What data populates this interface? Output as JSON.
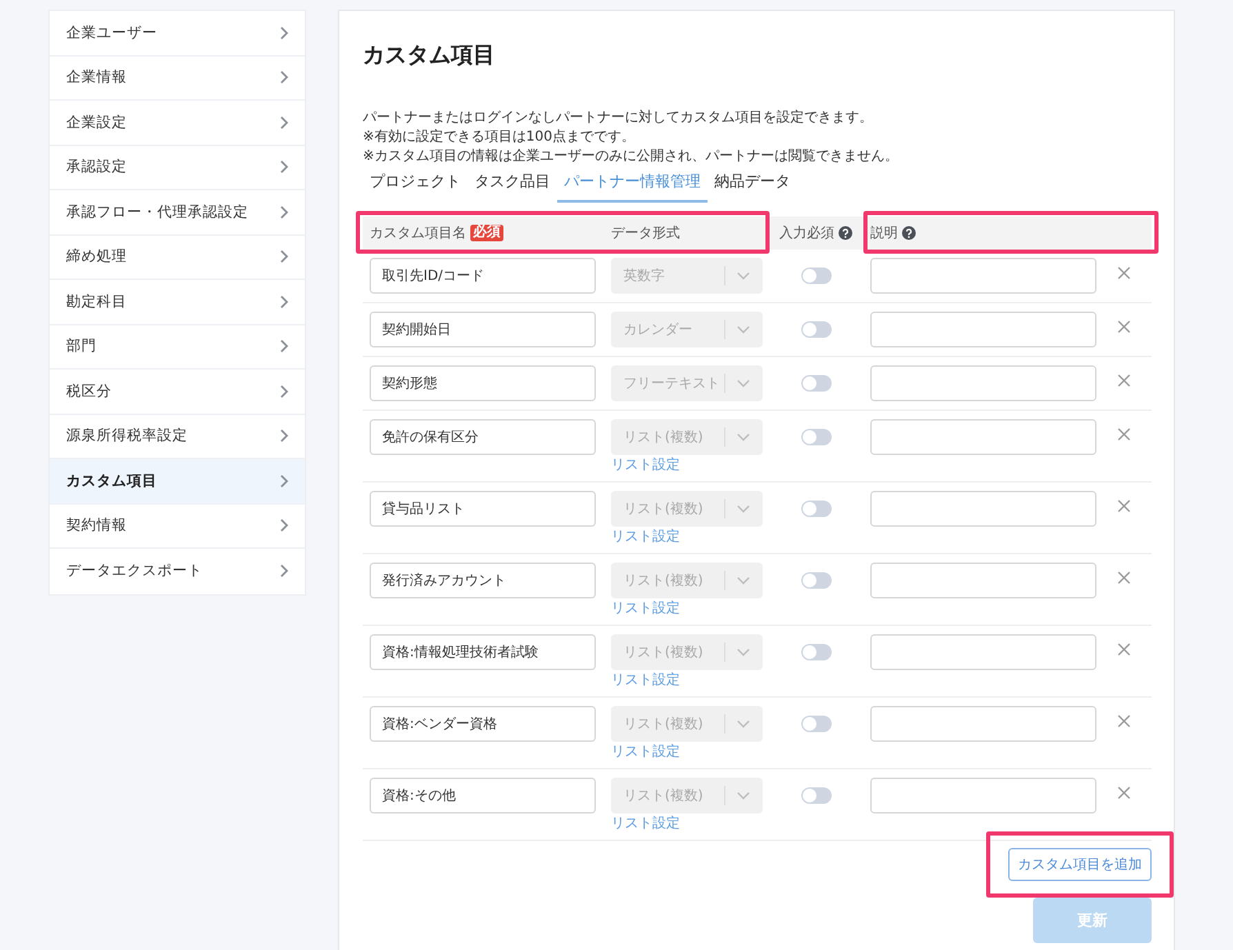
{
  "sidebar": {
    "items": [
      {
        "label": "企業ユーザー",
        "selected": false
      },
      {
        "label": "企業情報",
        "selected": false
      },
      {
        "label": "企業設定",
        "selected": false
      },
      {
        "label": "承認設定",
        "selected": false
      },
      {
        "label": "承認フロー・代理承認設定",
        "selected": false
      },
      {
        "label": "締め処理",
        "selected": false
      },
      {
        "label": "勘定科目",
        "selected": false
      },
      {
        "label": "部門",
        "selected": false
      },
      {
        "label": "税区分",
        "selected": false
      },
      {
        "label": "源泉所得税率設定",
        "selected": false
      },
      {
        "label": "カスタム項目",
        "selected": true
      },
      {
        "label": "契約情報",
        "selected": false
      },
      {
        "label": "データエクスポート",
        "selected": false
      }
    ]
  },
  "main": {
    "title": "カスタム項目",
    "description": [
      "パートナーまたはログインなしパートナーに対してカスタム項目を設定できます。",
      "※有効に設定できる項目は100点までです。",
      "※カスタム項目の情報は企業ユーザーのみに公開され、パートナーは閲覧できません。"
    ],
    "tabs": [
      {
        "label": "プロジェクト",
        "selected": false
      },
      {
        "label": "タスク品目",
        "selected": false
      },
      {
        "label": "パートナー情報管理",
        "selected": true
      },
      {
        "label": "納品データ",
        "selected": false
      }
    ],
    "table": {
      "columns": [
        {
          "label": "カスタム項目名",
          "badge": "必須",
          "highlighted": true
        },
        {
          "label": "データ形式",
          "highlighted": true
        },
        {
          "label": "入力必須",
          "help": true,
          "highlighted": false
        },
        {
          "label": "説明",
          "help": true,
          "highlighted": true
        }
      ],
      "rows": [
        {
          "name": "取引先ID/コード",
          "format": "英数字",
          "format_disabled": true,
          "required": false
        },
        {
          "name": "契約開始日",
          "format": "カレンダー",
          "format_disabled": true,
          "required": false
        },
        {
          "name": "契約形態",
          "format": "フリーテキスト",
          "format_disabled": true,
          "required": false
        },
        {
          "name": "免許の保有区分",
          "format": "リスト(複数)",
          "format_disabled": true,
          "required": false,
          "list_link": "リスト設定"
        },
        {
          "name": "貸与品リスト",
          "format": "リスト(複数)",
          "format_disabled": true,
          "required": false,
          "list_link": "リスト設定"
        },
        {
          "name": "発行済みアカウント",
          "format": "リスト(複数)",
          "format_disabled": true,
          "required": false,
          "list_link": "リスト設定"
        },
        {
          "name": "資格:情報処理技術者試験",
          "format": "リスト(複数)",
          "format_disabled": true,
          "required": false,
          "list_link": "リスト設定"
        },
        {
          "name": "資格:ベンダー資格",
          "format": "リスト(複数)",
          "format_disabled": true,
          "required": false,
          "list_link": "リスト設定"
        },
        {
          "name": "資格:その他",
          "format": "リスト(複数)",
          "format_disabled": true,
          "required": false,
          "list_link": "リスト設定"
        }
      ]
    },
    "add_button": {
      "label": "カスタム項目を追加",
      "highlighted": true
    },
    "save_button": {
      "label": "更新",
      "disabled": true
    }
  }
}
